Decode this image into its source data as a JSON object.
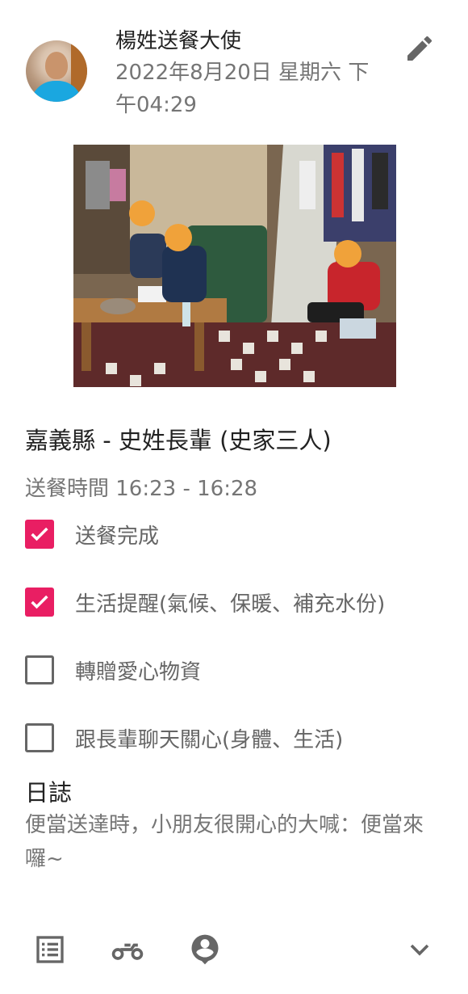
{
  "header": {
    "author_name": "楊姓送餐大使",
    "datetime": "2022年8月20日 星期六 下午04:29",
    "edit_icon": "pencil-icon"
  },
  "avatar_icon": "user-avatar",
  "photo_icon": "delivery-photo",
  "visit": {
    "location": "嘉義縣 - 史姓長輩 (史家三人)",
    "time_range": "送餐時間 16:23 - 16:28"
  },
  "checklist": [
    {
      "label": "送餐完成",
      "checked": true
    },
    {
      "label": "生活提醒(氣候、保暖、補充水份)",
      "checked": true
    },
    {
      "label": "轉贈愛心物資",
      "checked": false
    },
    {
      "label": "跟長輩聊天關心(身體、生活)",
      "checked": false
    }
  ],
  "log": {
    "title": "日誌",
    "text": "便當送達時，小朋友很開心的大喊：便當來囉~"
  },
  "toolbar": {
    "icons": [
      "list-icon",
      "motorcycle-icon",
      "person-pin-icon",
      "chevron-down-icon"
    ]
  },
  "colors": {
    "accent": "#e91e63",
    "text_primary": "#222222",
    "text_secondary": "#757575"
  }
}
